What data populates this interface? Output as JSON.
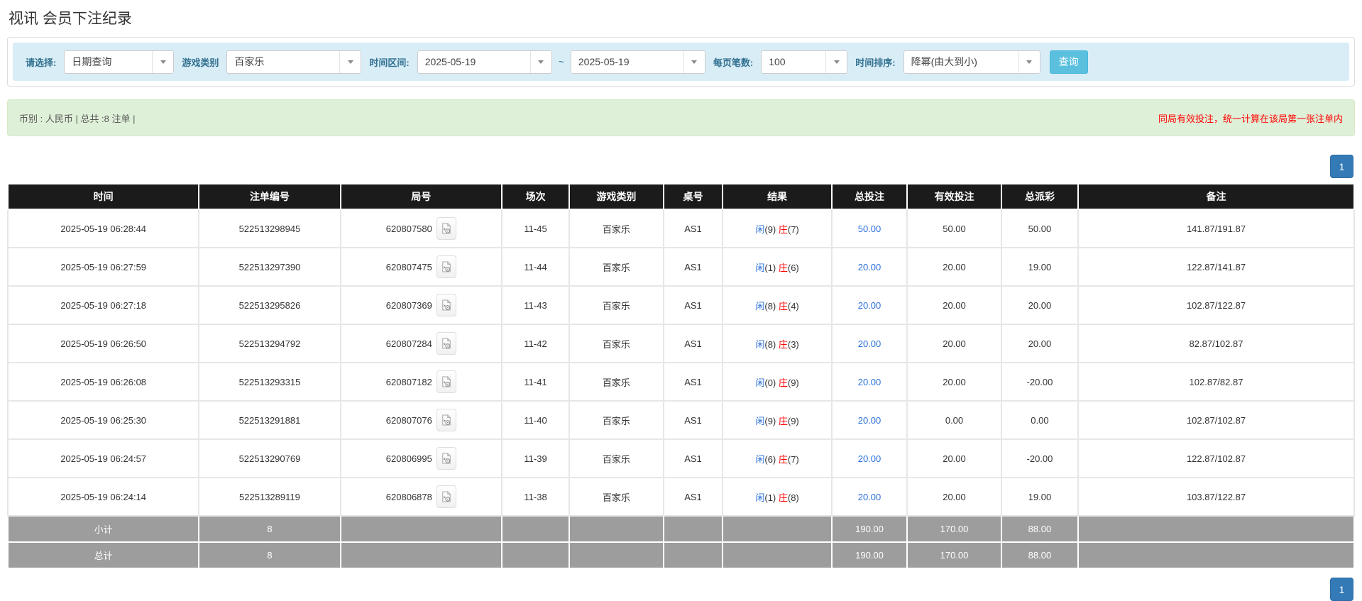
{
  "page": {
    "title": "视讯 会员下注纪录"
  },
  "colors": {
    "link_blue": "#2a6fdb",
    "accent_red": "#ff0000",
    "header_bg": "#1b1b1b",
    "footer_bg": "#9d9d9d",
    "search_btn": "#5bc0de",
    "page_btn": "#337ab7"
  },
  "filters": {
    "select_label": "请选择:",
    "select_value": "日期查询",
    "game_type_label": "游戏类别",
    "game_type_value": "百家乐",
    "date_range_label": "时间区间:",
    "date_from": "2025-05-19",
    "date_tilde": "~",
    "date_to": "2025-05-19",
    "page_size_label": "每页笔数:",
    "page_size_value": "100",
    "sort_label": "时间排序:",
    "sort_value": "降幂(由大到小)",
    "search_button": "查询"
  },
  "summary": {
    "left_text": "币别 : 人民币 | 总共 :8 注单 |",
    "right_note": "同局有效投注，统一计算在该局第一张注单内"
  },
  "pagination": {
    "page": "1"
  },
  "table": {
    "headers": [
      "时间",
      "注单编号",
      "局号",
      "场次",
      "游戏类别",
      "桌号",
      "结果",
      "总投注",
      "有效投注",
      "总派彩",
      "备注"
    ],
    "result_labels": {
      "player": "闲",
      "banker": "庄"
    },
    "video_icon": "video-file-icon",
    "rows": [
      {
        "time": "2025-05-19 06:28:44",
        "bet_id": "522513298945",
        "round_id": "620807580",
        "session": "11-45",
        "game": "百家乐",
        "table_no": "AS1",
        "player_score": "9",
        "banker_score": "7",
        "total_bet": "50.00",
        "valid_bet": "50.00",
        "payout": "50.00",
        "remark": "141.87/191.87"
      },
      {
        "time": "2025-05-19 06:27:59",
        "bet_id": "522513297390",
        "round_id": "620807475",
        "session": "11-44",
        "game": "百家乐",
        "table_no": "AS1",
        "player_score": "1",
        "banker_score": "6",
        "total_bet": "20.00",
        "valid_bet": "20.00",
        "payout": "19.00",
        "remark": "122.87/141.87"
      },
      {
        "time": "2025-05-19 06:27:18",
        "bet_id": "522513295826",
        "round_id": "620807369",
        "session": "11-43",
        "game": "百家乐",
        "table_no": "AS1",
        "player_score": "8",
        "banker_score": "4",
        "total_bet": "20.00",
        "valid_bet": "20.00",
        "payout": "20.00",
        "remark": "102.87/122.87"
      },
      {
        "time": "2025-05-19 06:26:50",
        "bet_id": "522513294792",
        "round_id": "620807284",
        "session": "11-42",
        "game": "百家乐",
        "table_no": "AS1",
        "player_score": "8",
        "banker_score": "3",
        "total_bet": "20.00",
        "valid_bet": "20.00",
        "payout": "20.00",
        "remark": "82.87/102.87"
      },
      {
        "time": "2025-05-19 06:26:08",
        "bet_id": "522513293315",
        "round_id": "620807182",
        "session": "11-41",
        "game": "百家乐",
        "table_no": "AS1",
        "player_score": "0",
        "banker_score": "9",
        "total_bet": "20.00",
        "valid_bet": "20.00",
        "payout": "-20.00",
        "remark": "102.87/82.87"
      },
      {
        "time": "2025-05-19 06:25:30",
        "bet_id": "522513291881",
        "round_id": "620807076",
        "session": "11-40",
        "game": "百家乐",
        "table_no": "AS1",
        "player_score": "9",
        "banker_score": "9",
        "total_bet": "20.00",
        "valid_bet": "0.00",
        "payout": "0.00",
        "remark": "102.87/102.87"
      },
      {
        "time": "2025-05-19 06:24:57",
        "bet_id": "522513290769",
        "round_id": "620806995",
        "session": "11-39",
        "game": "百家乐",
        "table_no": "AS1",
        "player_score": "6",
        "banker_score": "7",
        "total_bet": "20.00",
        "valid_bet": "20.00",
        "payout": "-20.00",
        "remark": "122.87/102.87"
      },
      {
        "time": "2025-05-19 06:24:14",
        "bet_id": "522513289119",
        "round_id": "620806878",
        "session": "11-38",
        "game": "百家乐",
        "table_no": "AS1",
        "player_score": "1",
        "banker_score": "8",
        "total_bet": "20.00",
        "valid_bet": "20.00",
        "payout": "19.00",
        "remark": "103.87/122.87"
      }
    ],
    "subtotal": {
      "label": "小计",
      "count": "8",
      "total_bet": "190.00",
      "valid_bet": "170.00",
      "payout": "88.00"
    },
    "total": {
      "label": "总计",
      "count": "8",
      "total_bet": "190.00",
      "valid_bet": "170.00",
      "payout": "88.00"
    }
  }
}
